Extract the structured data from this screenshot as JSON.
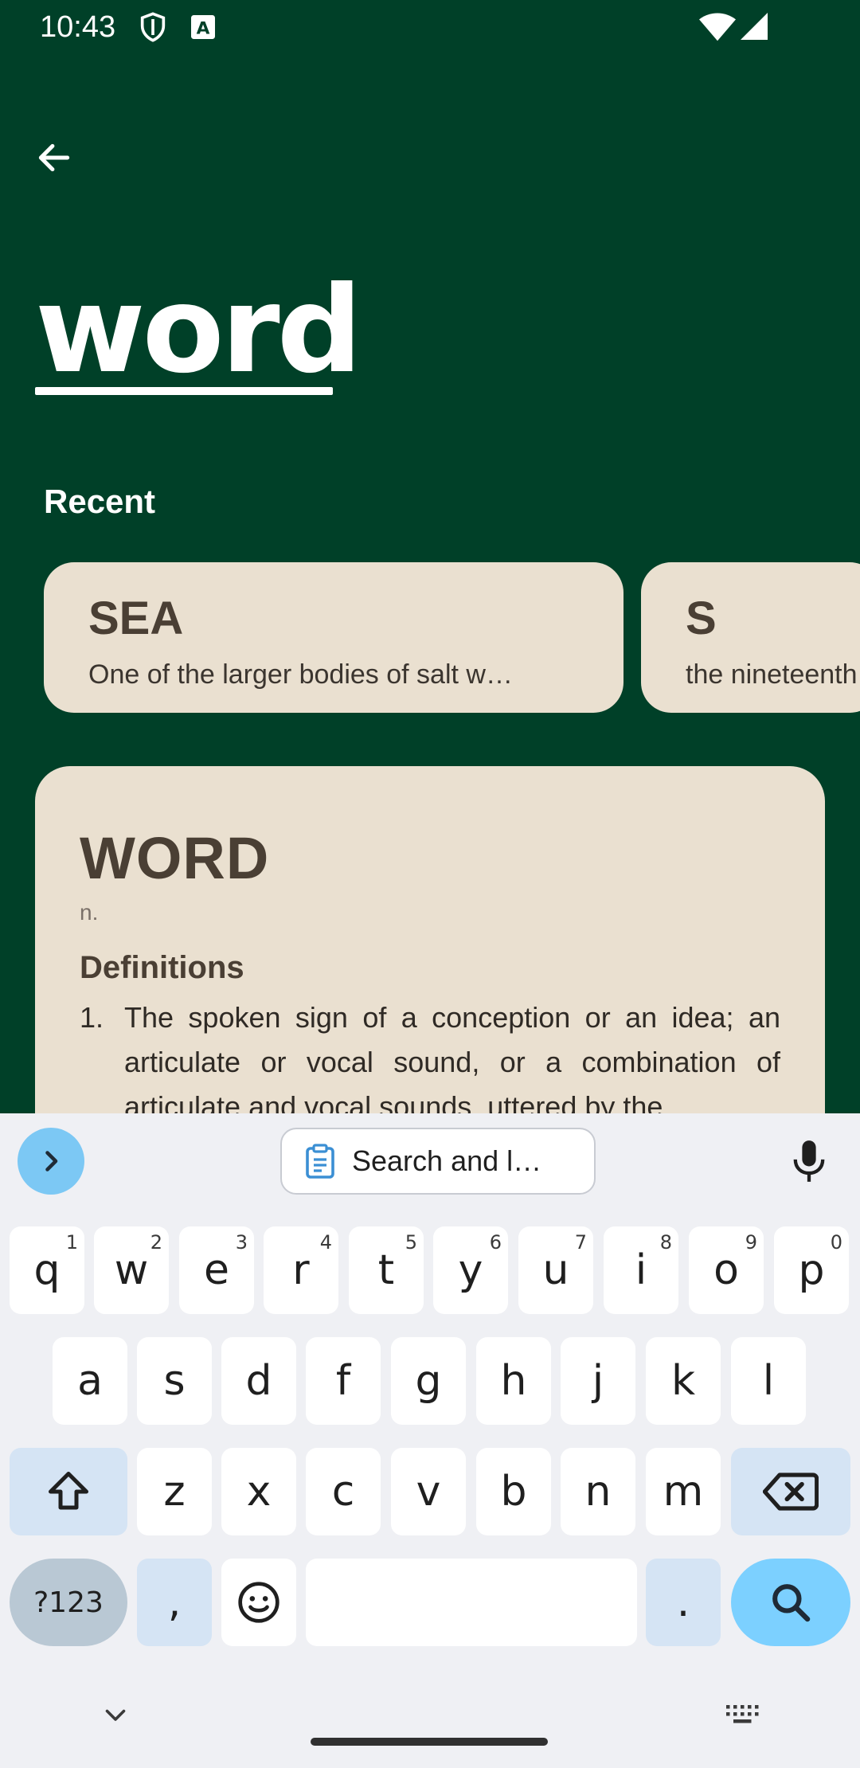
{
  "status_bar": {
    "time": "10:43",
    "icons": [
      "shield-icon",
      "font-badge-icon",
      "wifi-icon",
      "signal-icon"
    ]
  },
  "header": {
    "back_icon": "back-arrow-icon",
    "logo_text": "word"
  },
  "recent": {
    "title": "Recent",
    "items": [
      {
        "word": "SEA",
        "definition": "One of the larger bodies of salt w…"
      },
      {
        "word": "S",
        "definition": "the nineteenth"
      }
    ]
  },
  "definition_card": {
    "word": "WORD",
    "part_of_speech": "n.",
    "heading": "Definitions",
    "items": [
      {
        "number": "1.",
        "text": "The spoken sign of a conception or an idea; an articulate or vocal sound, or a combination of articulate and vocal sounds, uttered by the"
      }
    ]
  },
  "keyboard": {
    "suggestion_label": "Search and l…",
    "row1": [
      {
        "key": "q",
        "hint": "1"
      },
      {
        "key": "w",
        "hint": "2"
      },
      {
        "key": "e",
        "hint": "3"
      },
      {
        "key": "r",
        "hint": "4"
      },
      {
        "key": "t",
        "hint": "5"
      },
      {
        "key": "y",
        "hint": "6"
      },
      {
        "key": "u",
        "hint": "7"
      },
      {
        "key": "i",
        "hint": "8"
      },
      {
        "key": "o",
        "hint": "9"
      },
      {
        "key": "p",
        "hint": "0"
      }
    ],
    "row2": [
      "a",
      "s",
      "d",
      "f",
      "g",
      "h",
      "j",
      "k",
      "l"
    ],
    "row3": [
      "z",
      "x",
      "c",
      "v",
      "b",
      "n",
      "m"
    ],
    "symbols_label": "?123",
    "comma": ",",
    "period": "."
  },
  "colors": {
    "background": "#004028",
    "card": "#eae0d0",
    "keyboard_bg": "#eff0f4",
    "accent_key": "#7cd0ff"
  }
}
